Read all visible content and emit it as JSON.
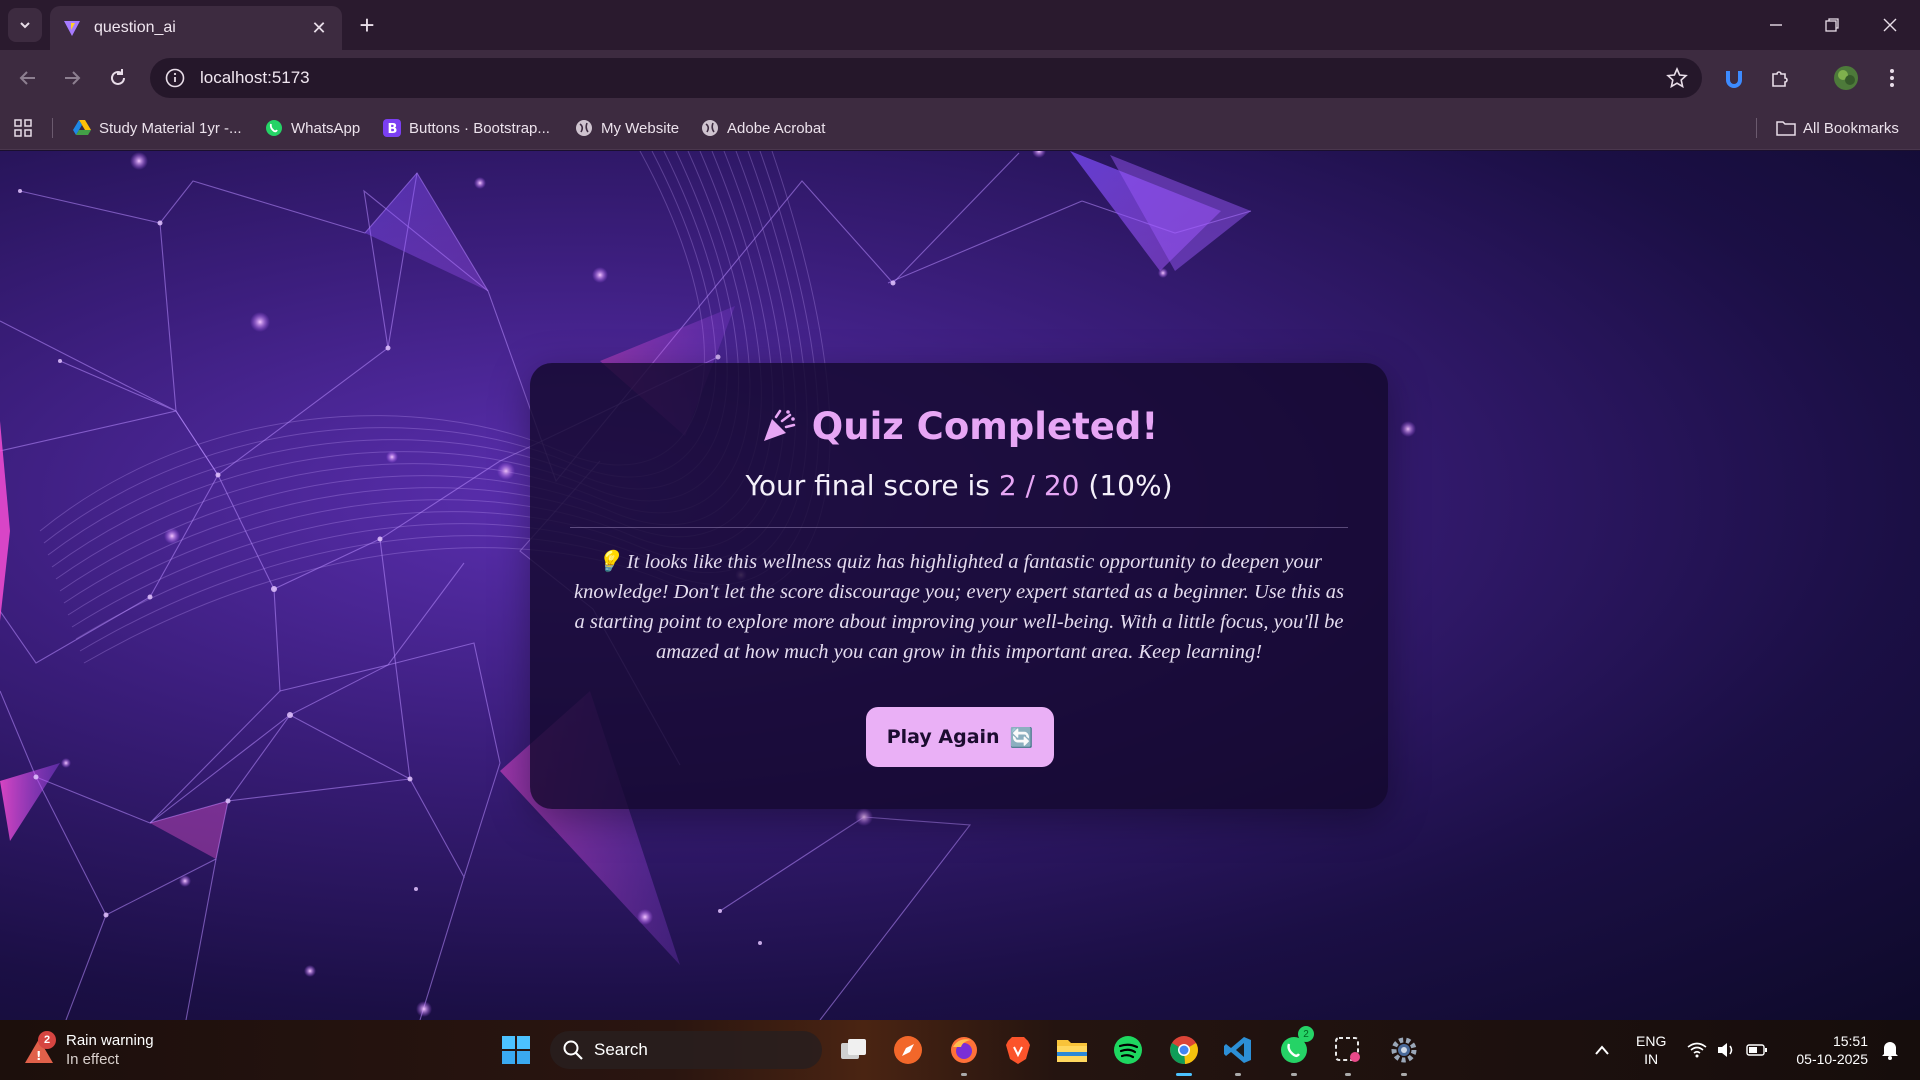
{
  "browser": {
    "tab": {
      "title": "question_ai"
    },
    "url": "localhost:5173",
    "bookmarks": [
      {
        "label": "Study Material 1yr -...",
        "icon": "google-drive-icon"
      },
      {
        "label": "WhatsApp",
        "icon": "whatsapp-icon"
      },
      {
        "label": "Buttons · Bootstrap...",
        "icon": "bootstrap-icon"
      },
      {
        "label": "My Website",
        "icon": "globe-icon"
      },
      {
        "label": "Adobe Acrobat",
        "icon": "globe-icon"
      }
    ],
    "all_bookmarks_label": "All Bookmarks"
  },
  "quiz": {
    "title": "Quiz Completed!",
    "score_prefix": "Your final score is",
    "score_value": "2 / 20",
    "score_percent": "(10%)",
    "feedback": "💡 It looks like this wellness quiz has highlighted a fantastic opportunity to deepen your knowledge! Don't let the score discourage you; every expert started as a beginner. Use this as a starting point to explore more about improving your well-being. With a little focus, you'll be amazed at how much you can grow in this important area. Keep learning!",
    "play_again_label": "Play Again",
    "play_again_icon": "🔄"
  },
  "taskbar": {
    "weather": {
      "title": "Rain warning",
      "subtitle": "In effect",
      "badge": "2"
    },
    "search_label": "Search",
    "whatsapp_badge": "2",
    "language": {
      "line1": "ENG",
      "line2": "IN"
    },
    "clock": {
      "time": "15:51",
      "date": "05-10-2025"
    }
  },
  "colors": {
    "accent": "#e7a6f5",
    "card_bg": "#14082d",
    "button_bg": "#eab0f6"
  }
}
